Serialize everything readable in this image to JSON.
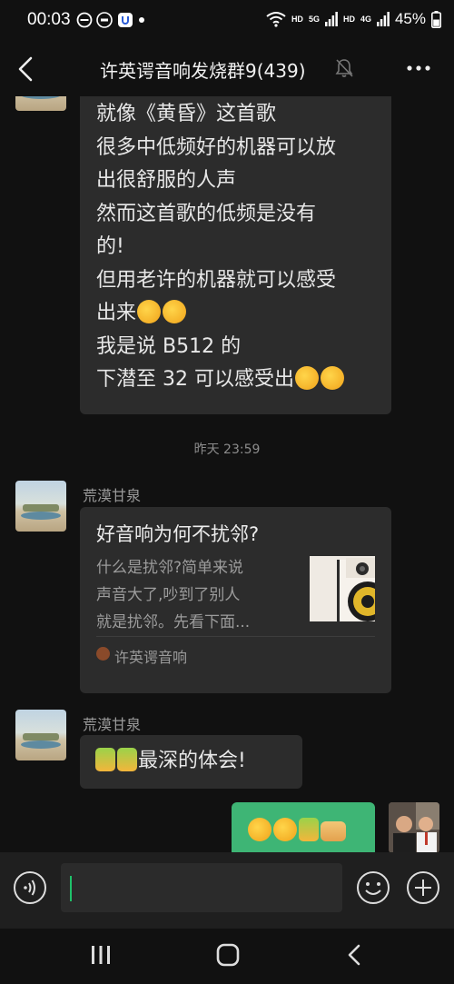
{
  "status_bar": {
    "time": "00:03",
    "net_hd1": "HD",
    "net_5g": "5G",
    "net_hd2": "HD",
    "net_4g": "4G",
    "battery": "45%"
  },
  "header": {
    "title": "许英谔音响发烧群9(439)"
  },
  "messages": [
    {
      "text": "就像《黄昏》这首歌\n很多中低频好的机器可以放\n出很舒服的人声\n然而这首歌的低频是没有\n的!\n但用老许的机器就可以感受\n出来",
      "text2": "我是说 B512 的\n下潜至 32 可以感受出"
    },
    {
      "timestamp": "昨天 23:59"
    },
    {
      "sender": "荒漠甘泉",
      "card": {
        "title": "好音响为何不扰邻?",
        "description": "什么是扰邻?简单来说\n声音大了,吵到了别人\n就是扰邻。先看下面...",
        "source": "许英谔音响"
      }
    },
    {
      "sender": "荒漠甘泉",
      "text": "最深的体会!"
    }
  ],
  "input": {
    "value": ""
  },
  "colors": {
    "accent_green": "#3eb575",
    "bubble_dark": "#2c2c2c",
    "background": "#111111"
  }
}
